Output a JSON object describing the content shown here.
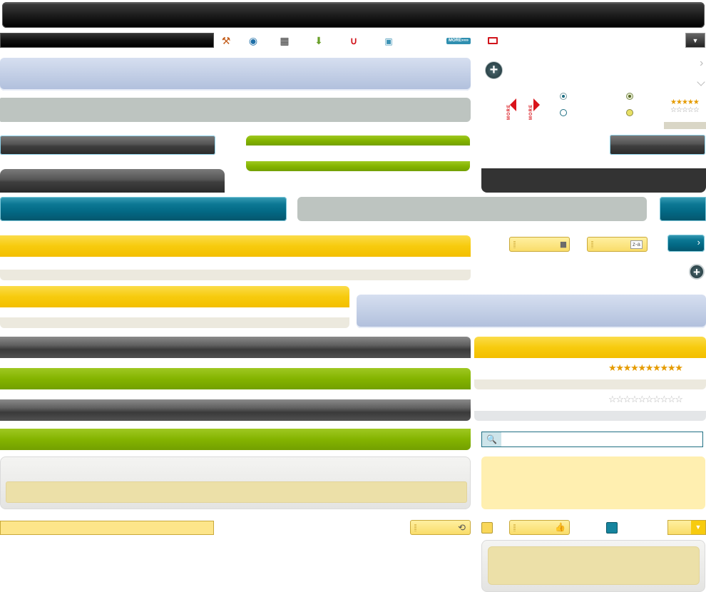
{
  "toolbar": {
    "icons": [
      {
        "name": "wrench-person-icon",
        "glyph": "⚒",
        "color": "#c25a17"
      },
      {
        "name": "play-icon",
        "glyph": "◉",
        "color": "#1f6fa8"
      },
      {
        "name": "film-icon",
        "glyph": "▦",
        "color": "#2e2e2e"
      },
      {
        "name": "download-icon",
        "glyph": "⬇",
        "color": "#6aa02a"
      },
      {
        "name": "magnet-icon",
        "glyph": "∪",
        "color": "#d1141b"
      },
      {
        "name": "grid-icon",
        "glyph": "▣",
        "color": "#3c92b4"
      }
    ],
    "more_label": "MORE»»»",
    "dropdown_glyph": "▼"
  },
  "widgets": {
    "add_glyph": "+",
    "more_label_left": "MORE",
    "more_label_right": "MORE",
    "zoom_glyph": "🔍",
    "thumb_glyph": "👍",
    "sort_glyph": "z-a",
    "bars_glyph": "▮▮",
    "return_glyph": "⟲",
    "chevron_glyph": "›",
    "dropdown_glyph": "▼"
  },
  "ratings": {
    "small": {
      "filled": 5,
      "total": 5
    },
    "small_empty": {
      "filled": 0,
      "total": 5
    },
    "large": {
      "filled": 10,
      "total": 10
    },
    "large_empty": {
      "filled": 0,
      "total": 10
    }
  },
  "colors": {
    "yellow": "#f7cb0e",
    "green": "#84b400",
    "teal": "#036985",
    "silver": "#bdc4c0",
    "blue": "#c3cfe6"
  }
}
